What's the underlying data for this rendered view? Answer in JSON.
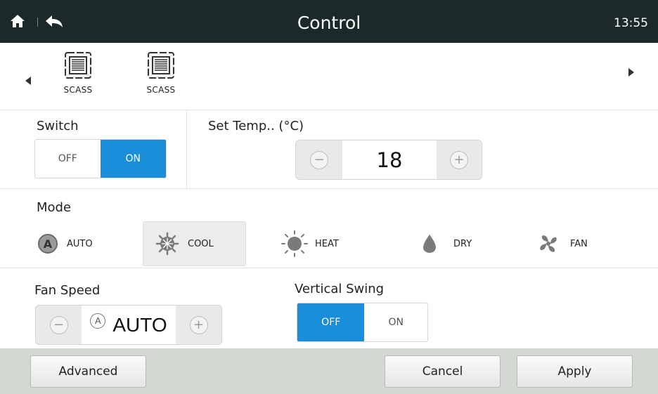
{
  "header": {
    "title": "Control",
    "time": "13:55",
    "home_icon": "home-icon",
    "back_icon": "back-icon"
  },
  "units": [
    {
      "label": "SCASS",
      "icon": "cassette-unit-icon"
    },
    {
      "label": "SCASS",
      "icon": "cassette-unit-icon"
    }
  ],
  "switch": {
    "title": "Switch",
    "off_label": "OFF",
    "on_label": "ON",
    "selected": "ON"
  },
  "temperature": {
    "title": "Set Temp.. (°C)",
    "value": "18",
    "minus": "−",
    "plus": "+"
  },
  "mode": {
    "title": "Mode",
    "selected": "COOL",
    "items": [
      {
        "label": "AUTO",
        "icon": "auto-mode-icon"
      },
      {
        "label": "COOL",
        "icon": "snowflake-icon"
      },
      {
        "label": "HEAT",
        "icon": "sun-icon"
      },
      {
        "label": "DRY",
        "icon": "droplet-icon"
      },
      {
        "label": "FAN",
        "icon": "fan-icon"
      }
    ]
  },
  "fan_speed": {
    "title": "Fan Speed",
    "value": "AUTO",
    "badge": "A",
    "minus": "−",
    "plus": "+"
  },
  "vertical_swing": {
    "title": "Vertical Swing",
    "off_label": "OFF",
    "on_label": "ON",
    "selected": "OFF"
  },
  "footer": {
    "advanced_label": "Advanced",
    "cancel_label": "Cancel",
    "apply_label": "Apply"
  },
  "colors": {
    "header_bg": "#1b2a28",
    "accent": "#1a8ed8",
    "footer_bg": "#d3d8d3"
  }
}
